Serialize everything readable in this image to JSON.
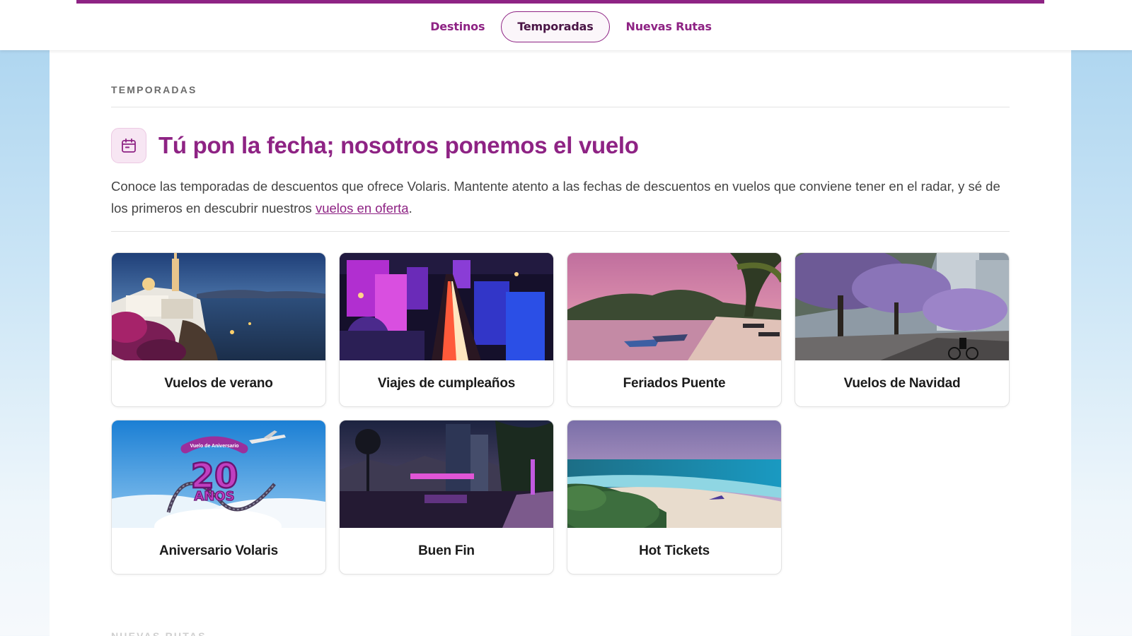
{
  "nav": {
    "items": [
      {
        "label": "Destinos",
        "active": false
      },
      {
        "label": "Temporadas",
        "active": true
      },
      {
        "label": "Nuevas Rutas",
        "active": false
      }
    ]
  },
  "section": {
    "label": "TEMPORADAS",
    "title": "Tú pon la fecha; nosotros ponemos el vuelo",
    "description_before": "Conoce las temporadas de descuentos que ofrece Volaris. Mantente atento a las fechas de descuentos en vuelos que conviene tener en el radar, y sé de los primeros en descubrir nuestros ",
    "description_link": "vuelos en oferta",
    "description_after": "."
  },
  "cards": [
    {
      "label": "Vuelos de verano"
    },
    {
      "label": "Viajes de cumpleaños"
    },
    {
      "label": "Feriados Puente"
    },
    {
      "label": "Vuelos de Navidad"
    },
    {
      "label": "Aniversario Volaris",
      "badge_top": "Vuelo de Aniversario",
      "badge_number": "20",
      "badge_bottom": "AÑOS"
    },
    {
      "label": "Buen Fin"
    },
    {
      "label": "Hot Tickets"
    }
  ],
  "next_section": {
    "label": "NUEVAS RUTAS"
  },
  "colors": {
    "brand": "#8e2384",
    "brand_dark": "#4a1546",
    "badge_bg": "#f7e6f3"
  },
  "icons": {
    "section": "calendar-icon"
  }
}
